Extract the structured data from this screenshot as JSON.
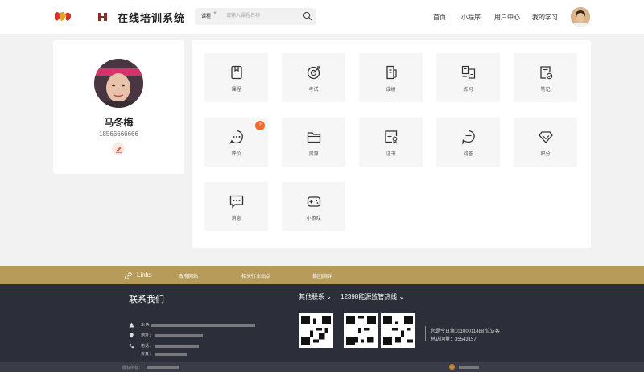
{
  "header": {
    "site_title": "在线培训系统",
    "search": {
      "category": "课程",
      "placeholder": "请输入课程名称"
    },
    "nav": [
      "首页",
      "小程序",
      "用户中心",
      "我的学习"
    ]
  },
  "profile": {
    "name": "马冬梅",
    "phone": "18566666666"
  },
  "tiles": [
    {
      "label": "课程",
      "icon": "book-icon"
    },
    {
      "label": "考试",
      "icon": "target-icon"
    },
    {
      "label": "成绩",
      "icon": "score-icon"
    },
    {
      "label": "练习",
      "icon": "practice-icon"
    },
    {
      "label": "笔记",
      "icon": "note-icon"
    },
    {
      "label": "评价",
      "icon": "comment-icon",
      "badge": "2"
    },
    {
      "label": "资源",
      "icon": "folder-icon"
    },
    {
      "label": "证书",
      "icon": "certificate-icon"
    },
    {
      "label": "问答",
      "icon": "qa-icon"
    },
    {
      "label": "积分",
      "icon": "diamond-icon"
    },
    {
      "label": "消息",
      "icon": "message-icon"
    },
    {
      "label": "小游戏",
      "icon": "gamepad-icon"
    }
  ],
  "links": {
    "title": "Links",
    "items": [
      "政府网站",
      "相关行业站点",
      "集团网群"
    ]
  },
  "footer": {
    "contact_title": "联系我们",
    "other_contact": "其他联系",
    "hotline": "12398能源监管热线",
    "address_prefix": "SHA",
    "address_label": "地址：",
    "phone_label": "电话：",
    "fax_label": "传真：",
    "visit_today": "您是今日第10100011488 位访客",
    "visit_total": "总访问量：35543157",
    "copyright_label": "版权所有："
  },
  "colors": {
    "accent": "#b69b5a",
    "badge": "#f26a2a",
    "footer_bg": "#2c2f39"
  }
}
